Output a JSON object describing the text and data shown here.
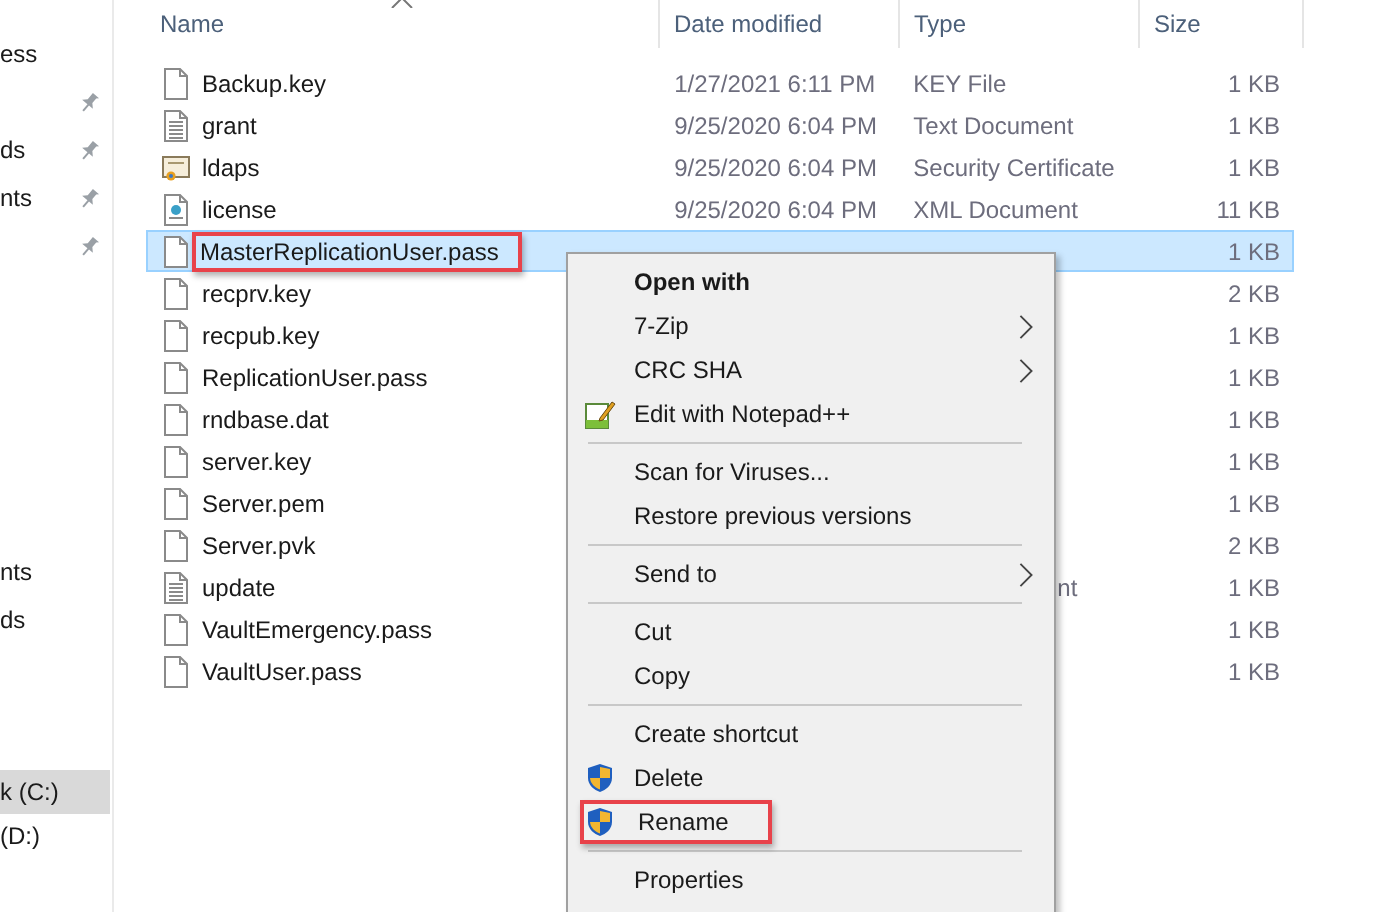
{
  "sidebar": {
    "groups": [
      {
        "items": [
          {
            "label": "ess",
            "pinned": false,
            "selected": false
          },
          {
            "pinned": true,
            "selected": false
          },
          {
            "label": "ds",
            "pinned": true,
            "selected": false
          },
          {
            "label": "nts",
            "pinned": true,
            "selected": false
          },
          {
            "pinned": true,
            "selected": false
          }
        ]
      },
      {
        "items": [
          {
            "label": "nts",
            "pinned": false,
            "selected": false
          },
          {
            "label": "ds",
            "pinned": false,
            "selected": false
          }
        ]
      },
      {
        "items": [
          {
            "label": "k (C:)",
            "pinned": false,
            "selected": true
          },
          {
            "label": "(D:)",
            "pinned": false,
            "selected": false
          }
        ]
      }
    ]
  },
  "table": {
    "columns": [
      "Name",
      "Date modified",
      "Type",
      "Size"
    ],
    "rows": [
      {
        "name": "Backup.key",
        "date": "1/27/2021 6:11 PM",
        "type": "KEY File",
        "size": "1 KB",
        "selected": false,
        "highlighted": false
      },
      {
        "name": "grant",
        "date": "9/25/2020 6:04 PM",
        "type": "Text Document",
        "size": "1 KB",
        "selected": false,
        "highlighted": false
      },
      {
        "name": "ldaps",
        "date": "9/25/2020 6:04 PM",
        "type": "Security Certificate",
        "size": "1 KB",
        "selected": false,
        "highlighted": false
      },
      {
        "name": "license",
        "date": "9/25/2020 6:04 PM",
        "type": "XML Document",
        "size": "11 KB",
        "selected": false,
        "highlighted": false
      },
      {
        "name": "MasterReplicationUser.pass",
        "size": "1 KB",
        "selected": true,
        "highlighted": true
      },
      {
        "name": "recprv.key",
        "size": "2 KB",
        "selected": false,
        "highlighted": false
      },
      {
        "name": "recpub.key",
        "size": "1 KB",
        "selected": false,
        "highlighted": false
      },
      {
        "name": "ReplicationUser.pass",
        "size": "1 KB",
        "selected": false,
        "highlighted": false
      },
      {
        "name": "rndbase.dat",
        "size": "1 KB",
        "selected": false,
        "highlighted": false
      },
      {
        "name": "server.key",
        "size": "1 KB",
        "selected": false,
        "highlighted": false
      },
      {
        "name": "Server.pem",
        "size": "1 KB",
        "selected": false,
        "highlighted": false
      },
      {
        "name": "Server.pvk",
        "size": "2 KB",
        "selected": false,
        "highlighted": false
      },
      {
        "name": "update",
        "type_fragment": "nt",
        "size": "1 KB",
        "selected": false,
        "highlighted": false
      },
      {
        "name": "VaultEmergency.pass",
        "size": "1 KB",
        "selected": false,
        "highlighted": false
      },
      {
        "name": "VaultUser.pass",
        "size": "1 KB",
        "selected": false,
        "highlighted": false
      }
    ]
  },
  "context_menu": {
    "items": [
      {
        "kind": "item",
        "label": "Open with",
        "bold": true,
        "submenu": false,
        "highlighted": false
      },
      {
        "kind": "item",
        "label": "7-Zip",
        "bold": false,
        "submenu": true,
        "highlighted": false
      },
      {
        "kind": "item",
        "label": "CRC SHA",
        "bold": false,
        "submenu": true,
        "highlighted": false
      },
      {
        "kind": "item",
        "label": "Edit with Notepad++",
        "bold": false,
        "submenu": false,
        "highlighted": false
      },
      {
        "kind": "separator"
      },
      {
        "kind": "item",
        "label": "Scan for Viruses...",
        "bold": false,
        "submenu": false,
        "highlighted": false
      },
      {
        "kind": "item",
        "label": "Restore previous versions",
        "bold": false,
        "submenu": false,
        "highlighted": false
      },
      {
        "kind": "separator"
      },
      {
        "kind": "item",
        "label": "Send to",
        "bold": false,
        "submenu": true,
        "highlighted": false
      },
      {
        "kind": "separator"
      },
      {
        "kind": "item",
        "label": "Cut",
        "bold": false,
        "submenu": false,
        "highlighted": false
      },
      {
        "kind": "item",
        "label": "Copy",
        "bold": false,
        "submenu": false,
        "highlighted": false
      },
      {
        "kind": "separator"
      },
      {
        "kind": "item",
        "label": "Create shortcut",
        "bold": false,
        "submenu": false,
        "highlighted": false
      },
      {
        "kind": "item",
        "label": "Delete",
        "bold": false,
        "submenu": false,
        "highlighted": false
      },
      {
        "kind": "item",
        "label": "Rename",
        "bold": false,
        "submenu": false,
        "highlighted": true
      },
      {
        "kind": "separator"
      },
      {
        "kind": "item",
        "label": "Properties",
        "bold": false,
        "submenu": false,
        "highlighted": false
      }
    ]
  }
}
